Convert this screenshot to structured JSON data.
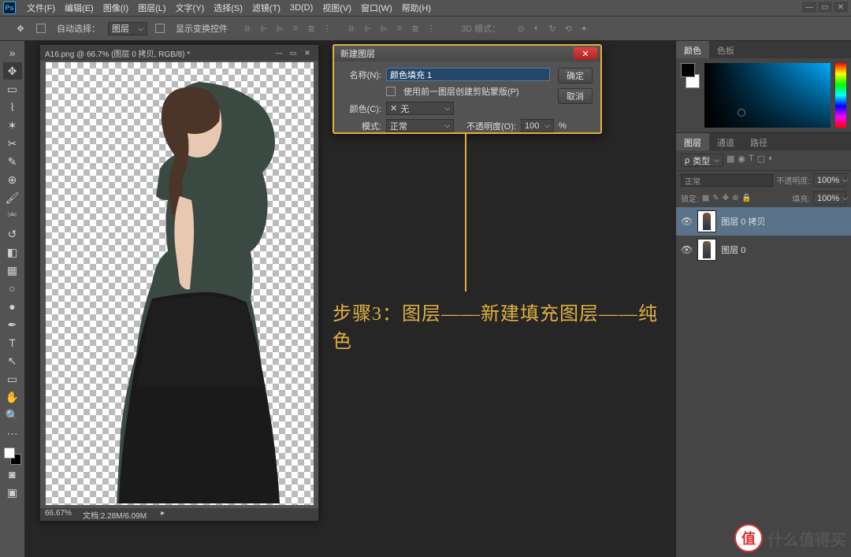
{
  "menubar": {
    "items": [
      "文件(F)",
      "编辑(E)",
      "图像(I)",
      "图层(L)",
      "文字(Y)",
      "选择(S)",
      "滤镜(T)",
      "3D(D)",
      "视图(V)",
      "窗口(W)",
      "帮助(H)"
    ]
  },
  "options": {
    "auto_select": "自动选择：",
    "group": "图层",
    "show_transform": "显示变换控件",
    "mode3d": "3D 模式："
  },
  "document": {
    "title": "A16.png @ 66.7% (图层 0 拷贝, RGB/8) *",
    "zoom": "66.67%",
    "filesize": "文档:2.28M/6.09M"
  },
  "dialog": {
    "title": "新建图层",
    "name_label": "名称(N):",
    "name_value": "颜色填充 1",
    "clip_mask": "使用前一图层创建剪贴蒙版(P)",
    "color_label": "颜色(C):",
    "color_value": "无",
    "mode_label": "模式:",
    "mode_value": "正常",
    "opacity_label": "不透明度(O):",
    "opacity_value": "100",
    "opacity_unit": "%",
    "ok": "确定",
    "cancel": "取消"
  },
  "annotation": "步骤3：图层——新建填充图层——纯色",
  "panels": {
    "color_tabs": {
      "active": "颜色",
      "other": "色板"
    },
    "layers_tabs": {
      "active": "图层",
      "t2": "通道",
      "t3": "路径"
    },
    "layer_kind": "类型",
    "blend_mode": "正常",
    "opacity_label": "不透明度:",
    "opacity_value": "100%",
    "lock_label": "锁定:",
    "fill_label": "填充:",
    "fill_value": "100%",
    "layers": [
      {
        "name": "图层 0 拷贝"
      },
      {
        "name": "图层 0"
      }
    ]
  },
  "watermark": {
    "badge": "值",
    "text": "什么值得买"
  }
}
